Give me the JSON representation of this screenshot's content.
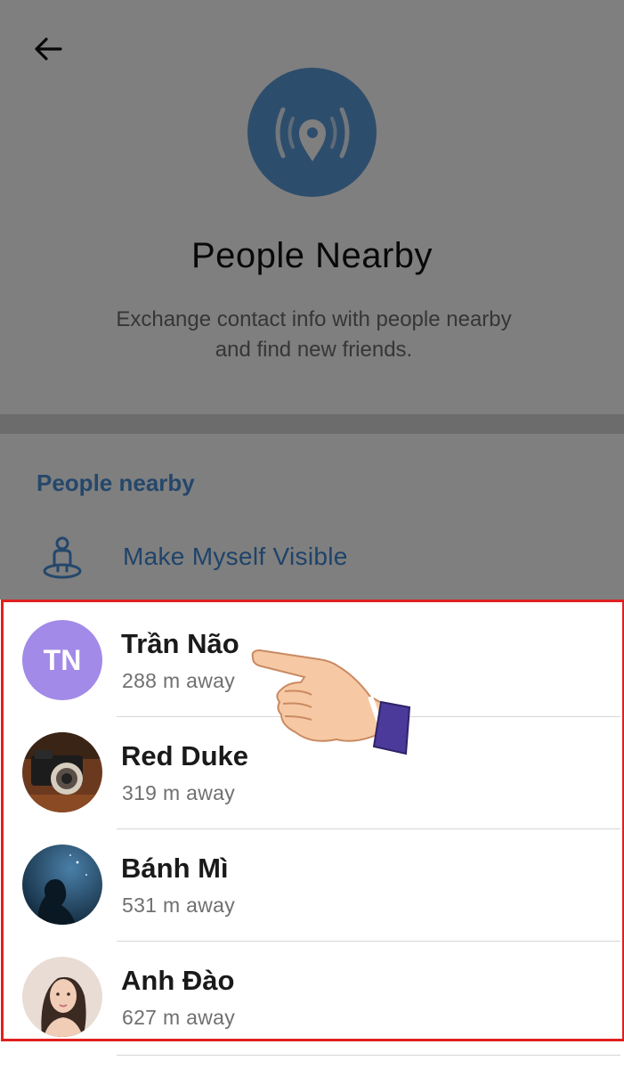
{
  "header": {
    "title": "People Nearby",
    "subtitle_line1": "Exchange contact info with people nearby",
    "subtitle_line2": "and find new friends."
  },
  "section": {
    "title": "People nearby",
    "make_visible_label": "Make Myself Visible"
  },
  "people": [
    {
      "name": "Trần Não",
      "distance": "288 m away",
      "avatar_initials": "TN",
      "avatar_color": "#a28ae8"
    },
    {
      "name": "Red Duke",
      "distance": "319 m away",
      "avatar_icon": "camera-photo"
    },
    {
      "name": "Bánh Mì",
      "distance": "531 m away",
      "avatar_icon": "night-sky-photo"
    },
    {
      "name": "Anh Đào",
      "distance": "627 m away",
      "avatar_icon": "portrait-photo"
    }
  ],
  "colors": {
    "accent": "#4a8fd6",
    "hero_icon_bg": "#5b9bd9",
    "highlight_border": "#e02020"
  },
  "icons": {
    "back": "arrow-left-icon",
    "hero": "location-broadcast-icon",
    "make_visible": "person-pin-icon",
    "pointer": "pointing-hand-icon"
  }
}
